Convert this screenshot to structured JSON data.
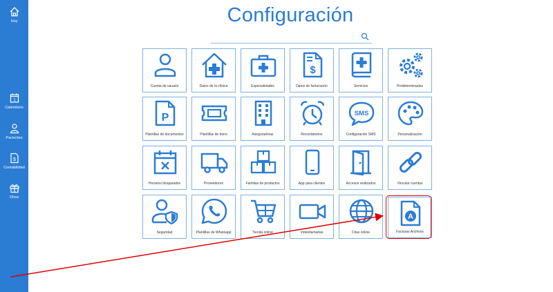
{
  "page": {
    "title": "Configuración"
  },
  "search": {
    "placeholder": ""
  },
  "sidebar": {
    "items": [
      {
        "label": "Hoy",
        "icon": "home-icon"
      },
      {
        "label": "Calendario",
        "icon": "calendar-icon"
      },
      {
        "label": "Pacientes",
        "icon": "person-icon"
      },
      {
        "label": "Contabilidad",
        "icon": "document-dollar-icon"
      },
      {
        "label": "Otros",
        "icon": "gift-icon"
      }
    ],
    "bottom": [
      {
        "icon": "gear-icon"
      },
      {
        "icon": "info-icon"
      }
    ]
  },
  "tiles": [
    {
      "label": "Cuenta de usuario",
      "icon": "user-icon"
    },
    {
      "label": "Datos de la clínica",
      "icon": "clinic-house-icon"
    },
    {
      "label": "Especialidades",
      "icon": "medical-kit-icon"
    },
    {
      "label": "Datos de facturación",
      "icon": "invoice-icon"
    },
    {
      "label": "Servicios",
      "icon": "medical-book-icon"
    },
    {
      "label": "Predeterminados",
      "icon": "gears-icon"
    },
    {
      "label": "Plantillas de documentos",
      "icon": "document-p-icon"
    },
    {
      "label": "Plantillas de bono",
      "icon": "ticket-icon"
    },
    {
      "label": "Aseguradoras",
      "icon": "building-icon"
    },
    {
      "label": "Recordatorios",
      "icon": "alarm-clock-icon"
    },
    {
      "label": "Configuración SMS",
      "icon": "sms-icon"
    },
    {
      "label": "Personalización",
      "icon": "palette-icon"
    },
    {
      "label": "Horarios bloqueados",
      "icon": "calendar-x-icon"
    },
    {
      "label": "Proveedores",
      "icon": "truck-icon"
    },
    {
      "label": "Familias de productos",
      "icon": "boxes-icon"
    },
    {
      "label": "App para clientes",
      "icon": "smartphone-icon"
    },
    {
      "label": "Accesos realizados",
      "icon": "door-icon"
    },
    {
      "label": "Vincular cuentas",
      "icon": "link-icon"
    },
    {
      "label": "Seguridad",
      "icon": "user-shield-icon"
    },
    {
      "label": "Plantillas de Whatsapp",
      "icon": "whatsapp-icon"
    },
    {
      "label": "Tienda online",
      "icon": "cart-icon"
    },
    {
      "label": "Videollamadas",
      "icon": "video-camera-icon"
    },
    {
      "label": "Citas online",
      "icon": "globe-icon"
    },
    {
      "label": "Facturas Archivos",
      "icon": "file-a-icon"
    }
  ],
  "colors": {
    "accent": "#2b7cd3",
    "highlight": "#e00000",
    "tile_border": "#7fb0e0"
  }
}
